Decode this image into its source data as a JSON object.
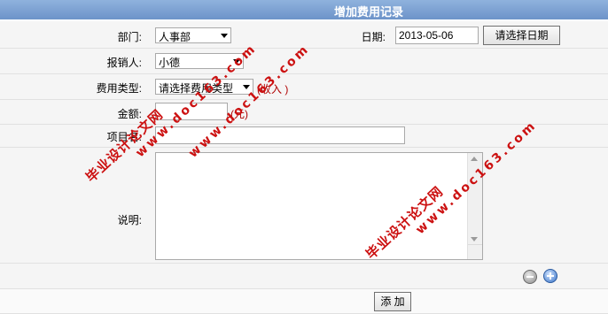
{
  "header": {
    "title": "增加费用记录"
  },
  "form": {
    "department": {
      "label": "部门:",
      "value": "人事部"
    },
    "date": {
      "label": "日期:",
      "value": "2013-05-06",
      "button": "请选择日期"
    },
    "claimant": {
      "label": "报销人:",
      "value": "小德"
    },
    "fee_type": {
      "label": "费用类型:",
      "value": "请选择费用类型",
      "unit_hint": "(收入 )"
    },
    "amount": {
      "label": "金额:",
      "value": "",
      "unit": "(元)"
    },
    "project_name": {
      "label": "项目名:",
      "value": ""
    },
    "description": {
      "label": "说明:",
      "value": ""
    },
    "submit_label": "添 加"
  },
  "watermarks": [
    {
      "line1": "毕业设计论文网",
      "line2": "www.doc163.com"
    },
    {
      "line1": "毕业设计论文网",
      "line2": "www.doc163.com"
    },
    {
      "line1": "毕业设计论文网",
      "line2": "www.doc163.com"
    }
  ],
  "colors": {
    "title_bar": "#7ea3d4",
    "row_bg": "#f5f5f5",
    "unit_text": "#b00000",
    "watermark": "#cc1111"
  }
}
